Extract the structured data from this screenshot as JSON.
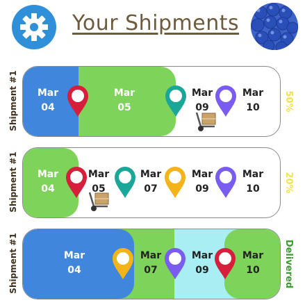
{
  "header": {
    "title": "Your Shipments",
    "settings_icon": "gear-icon",
    "avatar_icon": "blueberries-avatar"
  },
  "colors": {
    "blue": "#3f86dc",
    "green": "#7ed35a",
    "light_cyan": "#a8eef3",
    "yellow_status": "#f4e24a",
    "delivered_green": "#3a9c2e",
    "pin_red": "#d61f3a",
    "pin_teal": "#1aa79a",
    "pin_purple": "#7a5cf0",
    "pin_yellow": "#f2b418"
  },
  "shipments": [
    {
      "label": "Shipment #1",
      "status": "50%",
      "status_color": "#f4e24a",
      "progress": 0.5,
      "stops": [
        {
          "month": "Mar",
          "day": "04",
          "pin": "red",
          "text_color": "#ffffff"
        },
        {
          "month": "Mar",
          "day": "05",
          "pin": "teal",
          "text_color": "#ffffff"
        },
        {
          "month": "Mar",
          "day": "09",
          "pin": "purple",
          "text_color": "#222222"
        },
        {
          "month": "Mar",
          "day": "10",
          "pin": "none",
          "text_color": "#222222"
        }
      ]
    },
    {
      "label": "Shipment #1",
      "status": "20%",
      "status_color": "#f4e24a",
      "progress": 0.2,
      "stops": [
        {
          "month": "Mar",
          "day": "04",
          "pin": "red",
          "text_color": "#ffffff"
        },
        {
          "month": "Mar",
          "day": "05",
          "pin": "teal",
          "text_color": "#222222"
        },
        {
          "month": "Mar",
          "day": "07",
          "pin": "yellow",
          "text_color": "#222222"
        },
        {
          "month": "Mar",
          "day": "09",
          "pin": "purple",
          "text_color": "#222222"
        },
        {
          "month": "Mar",
          "day": "10",
          "pin": "none",
          "text_color": "#222222"
        }
      ]
    },
    {
      "label": "Shipment #1",
      "status": "Delivered",
      "status_color": "#3a9c2e",
      "progress": 1.0,
      "stops": [
        {
          "month": "Mar",
          "day": "04",
          "pin": "yellow",
          "text_color": "#ffffff"
        },
        {
          "month": "Mar",
          "day": "07",
          "pin": "purple",
          "text_color": "#222222"
        },
        {
          "month": "Mar",
          "day": "09",
          "pin": "red",
          "text_color": "#222222"
        },
        {
          "month": "Mar",
          "day": "10",
          "pin": "none",
          "text_color": "#222222"
        }
      ]
    }
  ]
}
